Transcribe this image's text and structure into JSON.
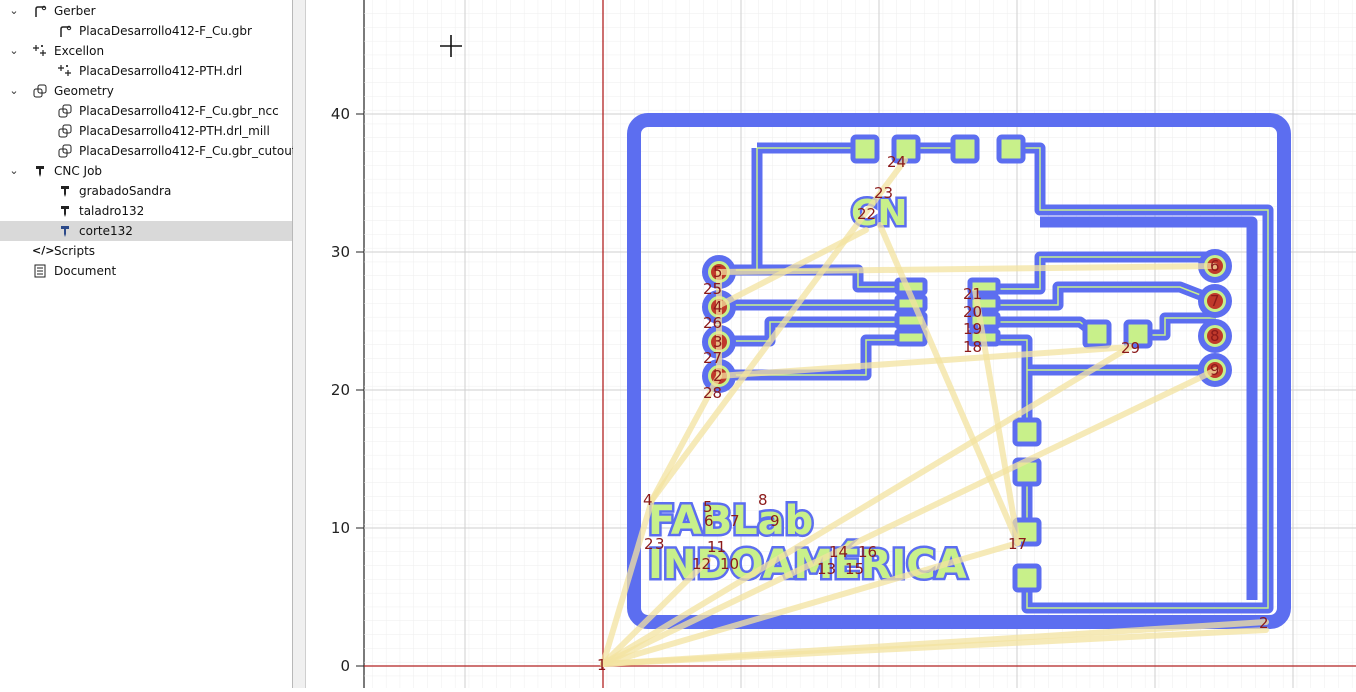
{
  "tree": {
    "gerber": {
      "label": "Gerber",
      "file": "PlacaDesarrollo412-F_Cu.gbr"
    },
    "excellon": {
      "label": "Excellon",
      "file": "PlacaDesarrollo412-PTH.drl"
    },
    "geometry": {
      "label": "Geometry",
      "files": [
        "PlacaDesarrollo412-F_Cu.gbr_ncc",
        "PlacaDesarrollo412-PTH.drl_mill",
        "PlacaDesarrollo412-F_Cu.gbr_cutout"
      ]
    },
    "cncjob": {
      "label": "CNC Job",
      "files": [
        "grabadoSandra",
        "taladro132",
        "corte132"
      ],
      "selected": "corte132"
    },
    "scripts": "Scripts",
    "document": "Document"
  },
  "plot": {
    "y_ticks": [
      "40",
      "30",
      "20",
      "10",
      "0"
    ],
    "board_text_1": "FABLab",
    "board_text_2": "INDOAMÉRICA",
    "board_text_cn": "CN",
    "points": [
      {
        "n": "1"
      },
      {
        "n": "2"
      },
      {
        "n": "2"
      },
      {
        "n": "3"
      },
      {
        "n": "4"
      },
      {
        "n": "5"
      },
      {
        "n": "6"
      },
      {
        "n": "7"
      },
      {
        "n": "8"
      },
      {
        "n": "9"
      },
      {
        "n": "10"
      },
      {
        "n": "11"
      },
      {
        "n": "12"
      },
      {
        "n": "13"
      },
      {
        "n": "14"
      },
      {
        "n": "15"
      },
      {
        "n": "16"
      },
      {
        "n": "17"
      },
      {
        "n": "18"
      },
      {
        "n": "19"
      },
      {
        "n": "20"
      },
      {
        "n": "21"
      },
      {
        "n": "22"
      },
      {
        "n": "23"
      },
      {
        "n": "24"
      },
      {
        "n": "25"
      },
      {
        "n": "26"
      },
      {
        "n": "27"
      },
      {
        "n": "28"
      },
      {
        "n": "29"
      },
      {
        "n": "5"
      },
      {
        "n": "4"
      },
      {
        "n": "3"
      },
      {
        "n": "2"
      },
      {
        "n": "6"
      },
      {
        "n": "7"
      },
      {
        "n": "8"
      },
      {
        "n": "9"
      }
    ]
  },
  "colors": {
    "copper": "#5c6ef0",
    "pad": "#c8f08a",
    "drill": "#c0392b",
    "path": "#f3e9a8",
    "axis": "#b22222",
    "label": "#8b1a1a"
  }
}
